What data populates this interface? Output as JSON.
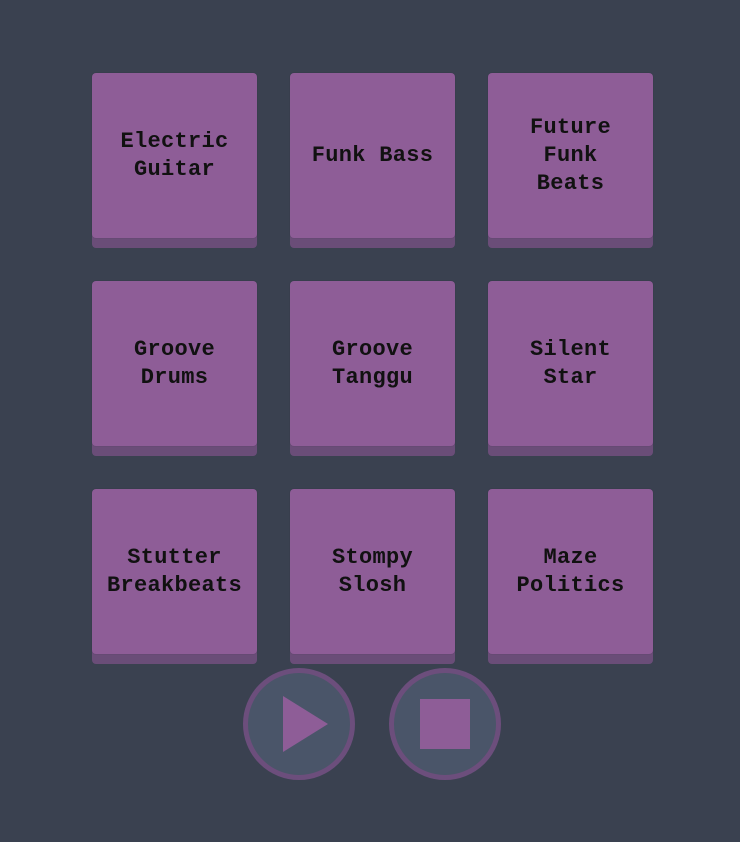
{
  "colors": {
    "background": "#3a4150",
    "pad": "#8e5d97",
    "pad_shadow": "#6a4d78",
    "control_bg": "#4a5569",
    "control_ring": "#6c4e7c",
    "label_text": "#111111"
  },
  "pads": [
    {
      "line1": "Electric",
      "line2": "Guitar",
      "line3": ""
    },
    {
      "line1": "Funk Bass",
      "line2": "",
      "line3": ""
    },
    {
      "line1": "Future",
      "line2": "Funk",
      "line3": "Beats"
    },
    {
      "line1": "Groove",
      "line2": "Drums",
      "line3": ""
    },
    {
      "line1": "Groove",
      "line2": "Tanggu",
      "line3": ""
    },
    {
      "line1": "Silent",
      "line2": "Star",
      "line3": ""
    },
    {
      "line1": "Stutter",
      "line2": "Breakbeats",
      "line3": ""
    },
    {
      "line1": "Stompy",
      "line2": "Slosh",
      "line3": ""
    },
    {
      "line1": "Maze",
      "line2": "Politics",
      "line3": ""
    }
  ],
  "controls": {
    "play_icon": "play-triangle-icon",
    "stop_icon": "stop-square-icon"
  }
}
